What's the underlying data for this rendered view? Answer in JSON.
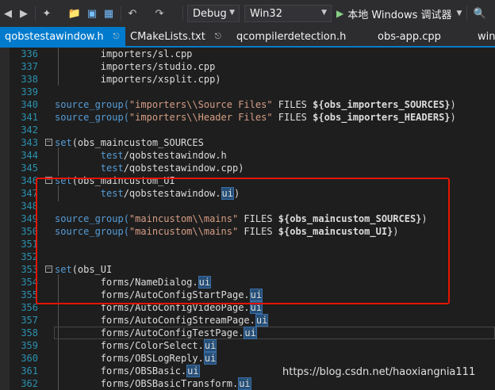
{
  "toolbar": {
    "config": "Debug",
    "platform": "Win32",
    "run_label": "本地 Windows 调试器"
  },
  "tabs": [
    {
      "label": "qobstestawindow.h",
      "active": true,
      "pinned": true
    },
    {
      "label": "CMakeLists.txt",
      "active": false,
      "pinned": true
    },
    {
      "label": "qcompilerdetection.h",
      "active": false,
      "pinned": false
    },
    {
      "label": "obs-app.cpp",
      "active": false,
      "pinned": false
    },
    {
      "label": "win",
      "active": false,
      "pinned": false
    }
  ],
  "lines": [
    {
      "n": "336",
      "tokens": [
        {
          "t": "        importers/sl.cpp"
        }
      ]
    },
    {
      "n": "337",
      "tokens": [
        {
          "t": "        importers/studio.cpp"
        }
      ]
    },
    {
      "n": "338",
      "tokens": [
        {
          "t": "        importers/xsplit.cpp)"
        }
      ]
    },
    {
      "n": "339",
      "tokens": []
    },
    {
      "n": "340",
      "tokens": [
        {
          "t": "source_group(",
          "c": "kw"
        },
        {
          "t": "\"importers\\\\Source Files\"",
          "c": "str"
        },
        {
          "t": " FILES "
        },
        {
          "t": "${obs_importers_SOURCES}",
          "c": "var"
        },
        {
          "t": ")"
        }
      ]
    },
    {
      "n": "341",
      "tokens": [
        {
          "t": "source_group(",
          "c": "kw"
        },
        {
          "t": "\"importers\\\\Header Files\"",
          "c": "str"
        },
        {
          "t": " FILES "
        },
        {
          "t": "${obs_importers_HEADERS}",
          "c": "var"
        },
        {
          "t": ")"
        }
      ]
    },
    {
      "n": "342",
      "tokens": []
    },
    {
      "n": "343",
      "fold": true,
      "tokens": [
        {
          "t": "set",
          "c": "kw"
        },
        {
          "t": "(obs_maincustom_SOURCES"
        }
      ]
    },
    {
      "n": "344",
      "tokens": [
        {
          "t": "        "
        },
        {
          "t": "test",
          "c": "kw"
        },
        {
          "t": "/qobstestawindow.h"
        }
      ]
    },
    {
      "n": "345",
      "tokens": [
        {
          "t": "        "
        },
        {
          "t": "test",
          "c": "kw"
        },
        {
          "t": "/qobstestawindow.cpp)"
        }
      ]
    },
    {
      "n": "346",
      "fold": true,
      "tokens": [
        {
          "t": "set",
          "c": "kw"
        },
        {
          "t": "(obs_maincustom_UI"
        }
      ]
    },
    {
      "n": "347",
      "tokens": [
        {
          "t": "        "
        },
        {
          "t": "test",
          "c": "kw"
        },
        {
          "t": "/qobstestawindow."
        },
        {
          "t": "ui",
          "c": "hl"
        },
        {
          "t": ")"
        }
      ]
    },
    {
      "n": "348",
      "tokens": []
    },
    {
      "n": "349",
      "tokens": [
        {
          "t": "source_group(",
          "c": "kw"
        },
        {
          "t": "\"maincustom\\\\mains\"",
          "c": "str"
        },
        {
          "t": " FILES "
        },
        {
          "t": "${obs_maincustom_SOURCES}",
          "c": "var"
        },
        {
          "t": ")"
        }
      ]
    },
    {
      "n": "350",
      "tokens": [
        {
          "t": "source_group(",
          "c": "kw"
        },
        {
          "t": "\"maincustom\\\\mains\"",
          "c": "str"
        },
        {
          "t": " FILES "
        },
        {
          "t": "${obs_maincustom_UI}",
          "c": "var"
        },
        {
          "t": ")"
        }
      ]
    },
    {
      "n": "351",
      "tokens": []
    },
    {
      "n": "352",
      "tokens": []
    },
    {
      "n": "353",
      "fold": true,
      "tokens": [
        {
          "t": "set",
          "c": "kw"
        },
        {
          "t": "(obs_UI"
        }
      ]
    },
    {
      "n": "354",
      "tokens": [
        {
          "t": "        forms/NameDialog."
        },
        {
          "t": "ui",
          "c": "hl"
        }
      ]
    },
    {
      "n": "355",
      "tokens": [
        {
          "t": "        forms/AutoConfigStartPage."
        },
        {
          "t": "ui",
          "c": "hl"
        }
      ]
    },
    {
      "n": "356",
      "tokens": [
        {
          "t": "        forms/AutoConfigVideoPage."
        },
        {
          "t": "ui",
          "c": "hl"
        }
      ]
    },
    {
      "n": "357",
      "tokens": [
        {
          "t": "        forms/AutoConfigStreamPage."
        },
        {
          "t": "ui",
          "c": "hl"
        }
      ]
    },
    {
      "n": "358",
      "current": true,
      "tokens": [
        {
          "t": "        forms/AutoConfigTestPage."
        },
        {
          "t": "ui",
          "c": "hl"
        }
      ]
    },
    {
      "n": "359",
      "tokens": [
        {
          "t": "        forms/ColorSelect."
        },
        {
          "t": "ui",
          "c": "hl"
        }
      ]
    },
    {
      "n": "360",
      "tokens": [
        {
          "t": "        forms/OBSLogReply."
        },
        {
          "t": "ui",
          "c": "hl"
        }
      ]
    },
    {
      "n": "361",
      "tokens": [
        {
          "t": "        forms/OBSBasic."
        },
        {
          "t": "ui",
          "c": "hl"
        }
      ]
    },
    {
      "n": "362",
      "tokens": [
        {
          "t": "        forms/OBSBasicTransform."
        },
        {
          "t": "ui",
          "c": "hl"
        }
      ]
    }
  ],
  "watermark": "https://blog.csdn.net/haoxiangnia111",
  "colors": {
    "background": "#1e1e1e",
    "accent": "#007acc",
    "highlight_box": "#e51400",
    "keyword": "#569cd6",
    "string": "#d69d85",
    "line_number": "#2b91af"
  }
}
